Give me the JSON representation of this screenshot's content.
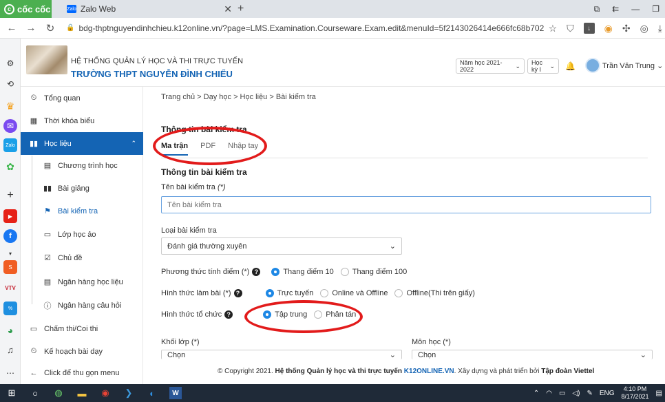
{
  "browser": {
    "logo": "cốc cốc",
    "tab_title": "Zalo Web",
    "tab_favicon_text": "Zalo",
    "url": "bdg-thptnguyendinhchieu.k12online.vn/?page=LMS.Examination.Courseware.Exam.edit&menuId=5f2143026414e666fc68b702"
  },
  "header": {
    "system_title": "HỆ THỐNG QUẢN LÝ HỌC VÀ THI TRỰC TUYẾN",
    "school_name": "TRƯỜNG THPT NGUYỄN ĐÌNH CHIỂU",
    "school_year": "Năm học 2021-2022",
    "semester": "Học kỳ I",
    "user_name": "Trần Văn Trung"
  },
  "sidebar": {
    "items": [
      {
        "label": "Tổng quan"
      },
      {
        "label": "Thời khóa biểu"
      },
      {
        "label": "Học liệu"
      },
      {
        "label": "Chương trình học"
      },
      {
        "label": "Bài giảng"
      },
      {
        "label": "Bài kiểm tra"
      },
      {
        "label": "Lớp học ảo"
      },
      {
        "label": "Chủ đề"
      },
      {
        "label": "Ngân hàng học liệu"
      },
      {
        "label": "Ngân hàng câu hỏi"
      },
      {
        "label": "Chấm thi/Coi thi"
      },
      {
        "label": "Kế hoạch bài dạy"
      },
      {
        "label": "Click để thu gọn menu"
      }
    ]
  },
  "breadcrumb": "Trang chủ > Dạy học > Học liệu > Bài kiểm tra",
  "card_title": "Thông tin bài kiểm tra",
  "tabs": [
    "Ma trận",
    "PDF",
    "Nhập tay"
  ],
  "section_title": "Thông tin bài kiểm tra",
  "form": {
    "name_label": "Tên bài kiểm tra",
    "required_mark": "(*)",
    "name_placeholder": "Tên bài kiểm tra",
    "type_label": "Loại bài kiểm tra",
    "type_value": "Đánh giá thường xuyên",
    "scoring_label": "Phương thức tính điểm (*)",
    "scoring_options": [
      "Thang điểm 10",
      "Thang điểm 100"
    ],
    "mode_label": "Hình thức làm bài (*)",
    "mode_options": [
      "Trực tuyến",
      "Online và Offline",
      "Offline(Thi trên giấy)"
    ],
    "org_label": "Hình thức tổ chức",
    "org_options": [
      "Tập trung",
      "Phân tán"
    ],
    "grade_label": "Khối lớp (*)",
    "grade_value": "Chọn",
    "subject_label": "Môn học (*)",
    "subject_value": "Chọn"
  },
  "footer": {
    "prefix": "© Copyright 2021.",
    "system": "Hệ thống Quản lý học và thi trực tuyến",
    "brand": "K12ONLINE.VN",
    "mid": ". Xây dựng và phát triển bởi",
    "company": "Tập đoàn Viettel"
  },
  "taskbar": {
    "lang": "ENG",
    "time": "4:10 PM",
    "date": "8/17/2021"
  },
  "colors": {
    "primary": "#1464b4",
    "annotation": "#e21b1b",
    "radio_on": "#1e88e5"
  }
}
